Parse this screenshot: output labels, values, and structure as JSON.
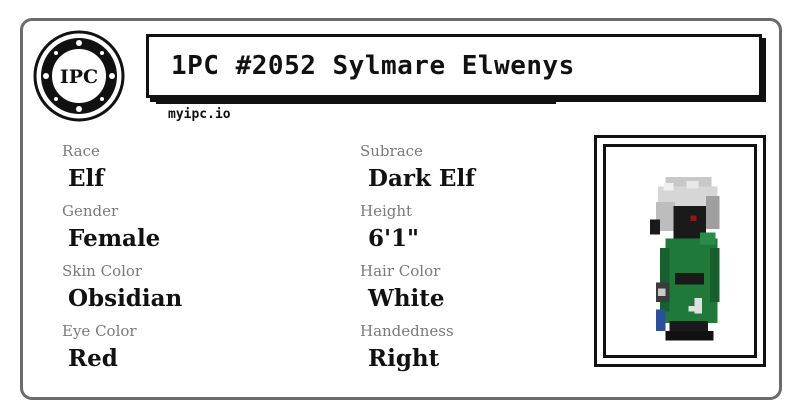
{
  "card": {
    "title": "1PC #2052 Sylmare Elwenys",
    "site": "myipc.io",
    "logo_text": "IPC"
  },
  "attributes": {
    "race_label": "Race",
    "race_value": "Elf",
    "subrace_label": "Subrace",
    "subrace_value": "Dark Elf",
    "gender_label": "Gender",
    "gender_value": "Female",
    "height_label": "Height",
    "height_value": "6'1\"",
    "skin_label": "Skin Color",
    "skin_value": "Obsidian",
    "hair_label": "Hair Color",
    "hair_value": "White",
    "eye_label": "Eye Color",
    "eye_value": "Red",
    "hand_label": "Handedness",
    "hand_value": "Right"
  },
  "colors": {
    "border": "#6b6b6b",
    "ink": "#111111",
    "label": "#7a7a7a",
    "cloak": "#1f7a3a",
    "hair": "#c8c8c8",
    "skin": "#1a1a1a"
  },
  "icons": {
    "logo": "ipc-seal-icon",
    "portrait": "pixel-character-sprite"
  }
}
